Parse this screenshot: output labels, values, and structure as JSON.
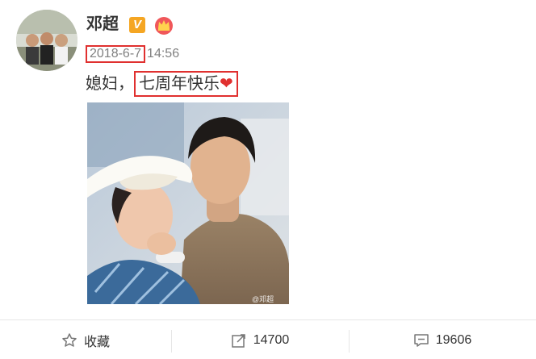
{
  "user": {
    "name": "邓超",
    "verified_badge": "V",
    "vip_icon": "crown-icon"
  },
  "post": {
    "date": "2018-6-7",
    "time": "14:56",
    "text_prefix": "媳妇，",
    "text_highlight": "七周年快乐",
    "heart": "❤",
    "image_watermark": "@邓超"
  },
  "actions": {
    "favorite_label": "收藏",
    "repost_count": "14700",
    "comment_count": "19606"
  },
  "colors": {
    "highlight_box": "#e0302f",
    "verified": "#f5a623",
    "text_gray": "#808080"
  }
}
